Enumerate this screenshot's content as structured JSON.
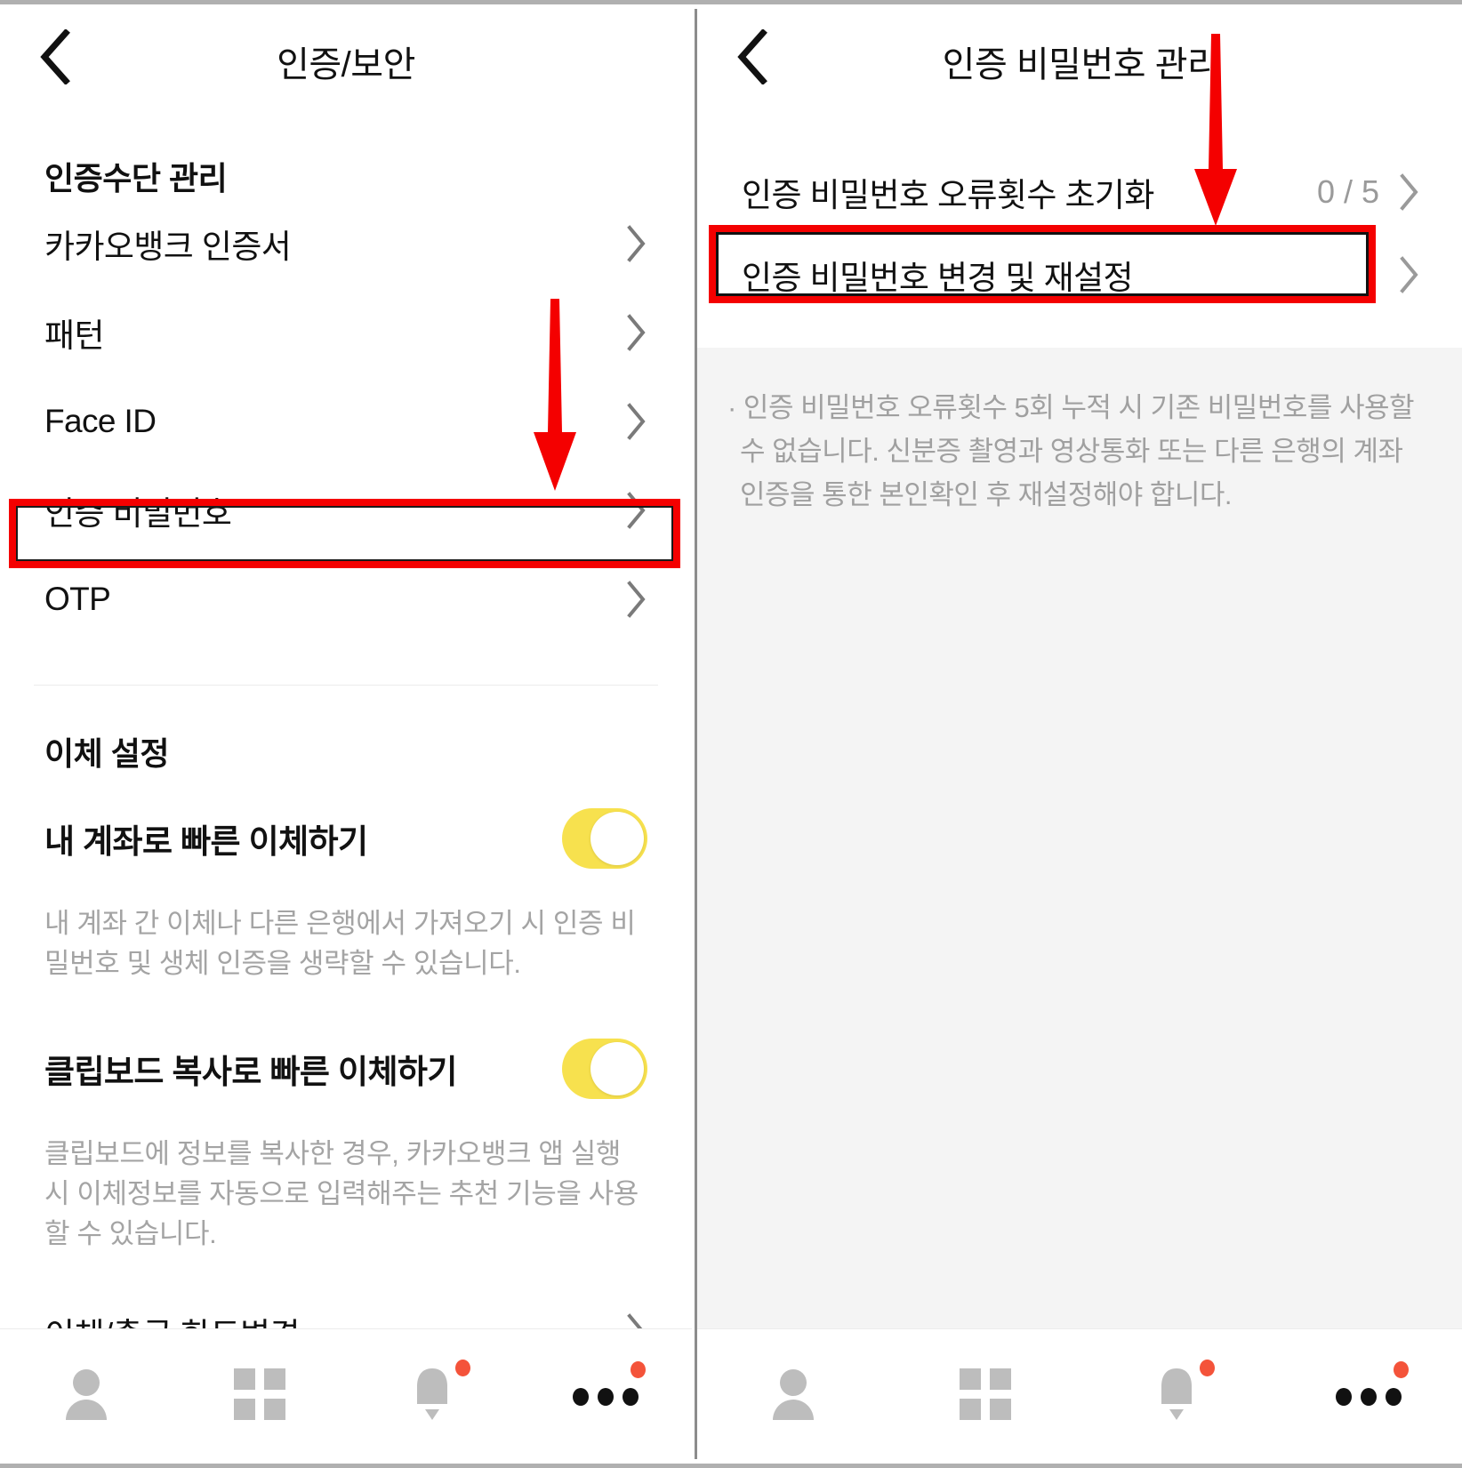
{
  "left": {
    "header": {
      "title": "인증/보안",
      "back_icon": "chevron-left-icon"
    },
    "section1": {
      "title": "인증수단 관리",
      "items": [
        {
          "label": "카카오뱅크 인증서"
        },
        {
          "label": "패턴"
        },
        {
          "label": "Face ID"
        },
        {
          "label": "인증 비밀번호",
          "highlighted": true
        },
        {
          "label": "OTP"
        }
      ]
    },
    "section2": {
      "title": "이체 설정",
      "toggles": [
        {
          "label": "내 계좌로 빠른 이체하기",
          "state": "on",
          "helper": "내 계좌 간 이체나 다른 은행에서 가져오기 시 인증 비밀번호 및 생체 인증을 생략할 수 있습니다."
        },
        {
          "label": "클립보드 복사로 빠른 이체하기",
          "state": "on",
          "helper": "클립보드에 정보를 복사한 경우, 카카오뱅크 앱 실행 시 이체정보를 자동으로 입력해주는 추천 기능을 사용할 수 있습니다."
        }
      ],
      "items": [
        {
          "label": "이체/출금 한도변경"
        }
      ]
    }
  },
  "right": {
    "header": {
      "title": "인증 비밀번호 관리",
      "back_icon": "chevron-left-icon"
    },
    "items": [
      {
        "label": "인증 비밀번호 오류횟수 초기화",
        "value": "0 / 5",
        "highlighted": false
      },
      {
        "label": "인증 비밀번호 변경 및 재설정",
        "value": "",
        "highlighted": true
      }
    ],
    "note": "· 인증 비밀번호 오류횟수 5회 누적 시 기존 비밀번호를 사용할 수 없습니다. 신분증 촬영과 영상통화 또는 다른 은행의 계좌 인증을 통한 본인확인 후 재설정해야 합니다."
  },
  "navbar": {
    "items": [
      {
        "icon": "person-icon",
        "badge": false
      },
      {
        "icon": "grid-icon",
        "badge": false
      },
      {
        "icon": "bell-icon",
        "badge": true
      },
      {
        "icon": "more-dots-icon",
        "badge": true
      }
    ]
  },
  "annotations": {
    "arrow_color": "#f40000",
    "highlight_border_color": "#f40000",
    "toggle_on_color": "#f7e14e",
    "badge_color": "#f4533a"
  }
}
